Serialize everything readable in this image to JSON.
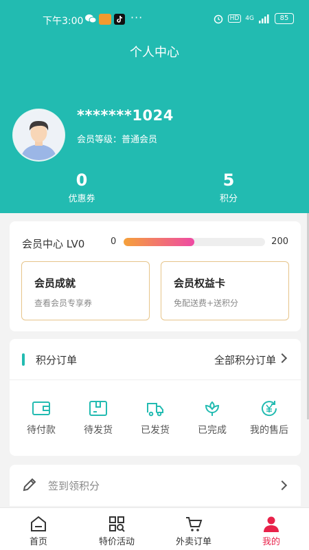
{
  "status_bar": {
    "time": "下午3:00",
    "dots": "···",
    "network": "4G",
    "hd": "HD",
    "battery": "85"
  },
  "header": {
    "title": "个人中心",
    "username": "*******1024",
    "level_label": "会员等级：",
    "level_value": "普通会员",
    "stats": [
      {
        "value": "0",
        "label": "优惠券"
      },
      {
        "value": "5",
        "label": "积分"
      }
    ]
  },
  "member": {
    "title": "会员中心 LV0",
    "progress_min": "0",
    "progress_max": "200",
    "progress_fraction": 0.5,
    "cards": [
      {
        "title": "会员成就",
        "subtitle": "查看会员专享券"
      },
      {
        "title": "会员权益卡",
        "subtitle": "免配送费+送积分"
      }
    ]
  },
  "orders": {
    "title": "积分订单",
    "all_label": "全部积分订单",
    "items": [
      {
        "label": "待付款",
        "icon": "wallet-icon"
      },
      {
        "label": "待发货",
        "icon": "package-icon"
      },
      {
        "label": "已发货",
        "icon": "truck-icon"
      },
      {
        "label": "已完成",
        "icon": "flower-icon"
      },
      {
        "label": "我的售后",
        "icon": "yuan-return-icon"
      }
    ]
  },
  "signin": {
    "label": "签到领积分"
  },
  "bottom_nav": [
    {
      "label": "首页",
      "icon": "home-icon",
      "active": false
    },
    {
      "label": "特价活动",
      "icon": "grid-search-icon",
      "active": false
    },
    {
      "label": "外卖订单",
      "icon": "cart-icon",
      "active": false
    },
    {
      "label": "我的",
      "icon": "person-icon",
      "active": true
    }
  ],
  "colors": {
    "primary": "#22bbb1",
    "active": "#e8224a",
    "card_border": "#e6c489"
  }
}
